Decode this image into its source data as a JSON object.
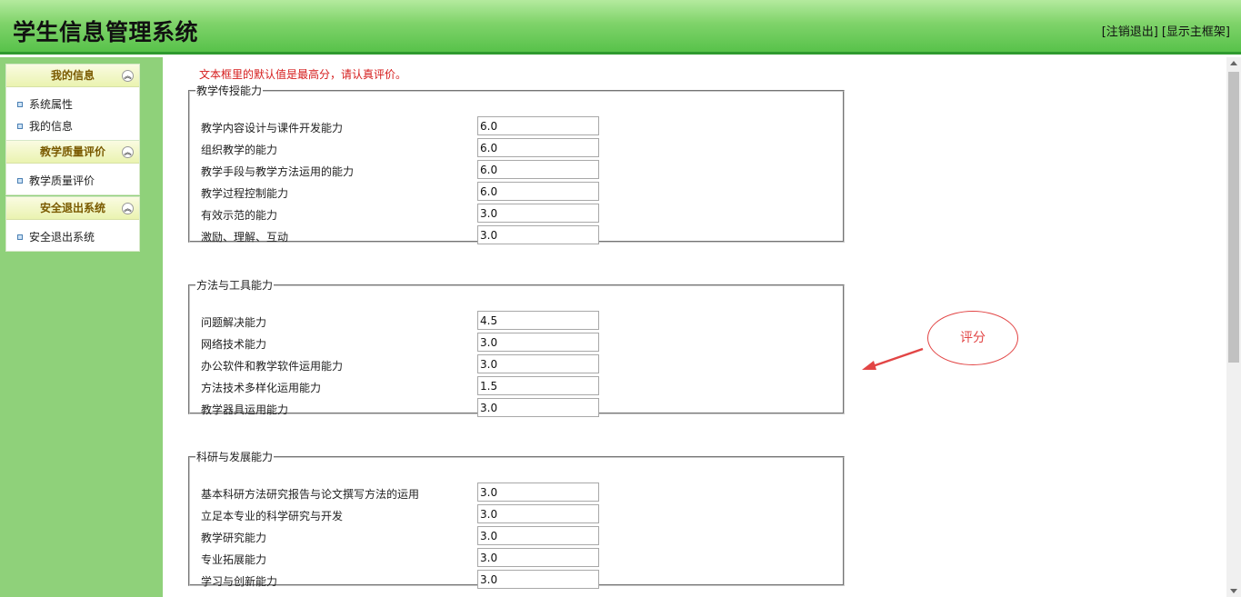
{
  "header": {
    "title": "学生信息管理系统",
    "logout_link": "[注销退出]",
    "frame_link": "[显示主框架]"
  },
  "sidebar": {
    "panels": [
      {
        "title": "我的信息",
        "items": [
          "系统属性",
          "我的信息"
        ]
      },
      {
        "title": "教学质量评价",
        "items": [
          "教学质量评价"
        ]
      },
      {
        "title": "安全退出系统",
        "items": [
          "安全退出系统"
        ]
      }
    ]
  },
  "main": {
    "notice": "文本框里的默认值是最高分，请认真评价。",
    "groups": [
      {
        "title": "教学传授能力",
        "items": [
          {
            "label": "教学内容设计与课件开发能力",
            "value": "6.0"
          },
          {
            "label": "组织教学的能力",
            "value": "6.0"
          },
          {
            "label": "教学手段与教学方法运用的能力",
            "value": "6.0"
          },
          {
            "label": "教学过程控制能力",
            "value": "6.0"
          },
          {
            "label": "有效示范的能力",
            "value": "3.0"
          },
          {
            "label": "激励、理解、互动",
            "value": "3.0"
          }
        ]
      },
      {
        "title": "方法与工具能力",
        "items": [
          {
            "label": "问题解决能力",
            "value": "4.5"
          },
          {
            "label": "网络技术能力",
            "value": "3.0"
          },
          {
            "label": "办公软件和教学软件运用能力",
            "value": "3.0"
          },
          {
            "label": "方法技术多样化运用能力",
            "value": "1.5"
          },
          {
            "label": "教学器具运用能力",
            "value": "3.0"
          }
        ]
      },
      {
        "title": "科研与发展能力",
        "items": [
          {
            "label": "基本科研方法研究报告与论文撰写方法的运用",
            "value": "3.0"
          },
          {
            "label": "立足本专业的科学研究与开发",
            "value": "3.0"
          },
          {
            "label": "教学研究能力",
            "value": "3.0"
          },
          {
            "label": "专业拓展能力",
            "value": "3.0"
          },
          {
            "label": "学习与创新能力",
            "value": "3.0"
          }
        ]
      }
    ]
  },
  "annotation": {
    "label": "评分",
    "color": "#e24545"
  }
}
